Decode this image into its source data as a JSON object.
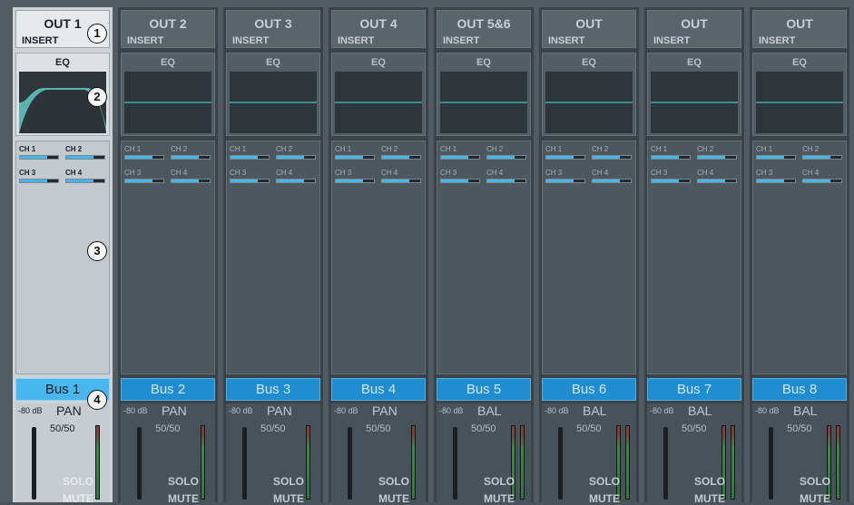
{
  "strips": [
    {
      "title": "OUT 1",
      "insert": "INSERT",
      "eq": "EQ",
      "bus": "Bus 1",
      "db": "-80 dB",
      "pan_mode": "PAN",
      "pan_value": "50/50",
      "solo": "SOLO",
      "mute": "MUTE",
      "selected": true,
      "meters": 1,
      "sends": [
        {
          "label": "CH 1",
          "level": 0.72
        },
        {
          "label": "CH 2",
          "level": 0.72
        },
        {
          "label": "CH 3",
          "level": 0.72
        },
        {
          "label": "CH 4",
          "level": 0.72
        }
      ]
    },
    {
      "title": "OUT 2",
      "insert": "INSERT",
      "eq": "EQ",
      "bus": "Bus 2",
      "db": "-80 dB",
      "pan_mode": "PAN",
      "pan_value": "50/50",
      "solo": "SOLO",
      "mute": "MUTE",
      "selected": false,
      "meters": 1,
      "sends": [
        {
          "label": "CH 1",
          "level": 0.72
        },
        {
          "label": "CH 2",
          "level": 0.72
        },
        {
          "label": "CH 3",
          "level": 0.72
        },
        {
          "label": "CH 4",
          "level": 0.72
        }
      ]
    },
    {
      "title": "OUT 3",
      "insert": "INSERT",
      "eq": "EQ",
      "bus": "Bus 3",
      "db": "-80 dB",
      "pan_mode": "PAN",
      "pan_value": "50/50",
      "solo": "SOLO",
      "mute": "MUTE",
      "selected": false,
      "meters": 1,
      "sends": [
        {
          "label": "CH 1",
          "level": 0.72
        },
        {
          "label": "CH 2",
          "level": 0.72
        },
        {
          "label": "CH 3",
          "level": 0.72
        },
        {
          "label": "CH 4",
          "level": 0.72
        }
      ]
    },
    {
      "title": "OUT 4",
      "insert": "INSERT",
      "eq": "EQ",
      "bus": "Bus 4",
      "db": "-80 dB",
      "pan_mode": "PAN",
      "pan_value": "50/50",
      "solo": "SOLO",
      "mute": "MUTE",
      "selected": false,
      "meters": 1,
      "sends": [
        {
          "label": "CH 1",
          "level": 0.72
        },
        {
          "label": "CH 2",
          "level": 0.72
        },
        {
          "label": "CH 3",
          "level": 0.72
        },
        {
          "label": "CH 4",
          "level": 0.72
        }
      ]
    },
    {
      "title": "OUT 5&6",
      "insert": "INSERT",
      "eq": "EQ",
      "bus": "Bus 5",
      "db": "-80 dB",
      "pan_mode": "BAL",
      "pan_value": "50/50",
      "solo": "SOLO",
      "mute": "MUTE",
      "selected": false,
      "meters": 2,
      "sends": [
        {
          "label": "CH 1",
          "level": 0.72
        },
        {
          "label": "CH 2",
          "level": 0.72
        },
        {
          "label": "CH 3",
          "level": 0.72
        },
        {
          "label": "CH 4",
          "level": 0.72
        }
      ]
    },
    {
      "title": "OUT",
      "insert": "INSERT",
      "eq": "EQ",
      "bus": "Bus 6",
      "db": "-80 dB",
      "pan_mode": "BAL",
      "pan_value": "50/50",
      "solo": "SOLO",
      "mute": "MUTE",
      "selected": false,
      "meters": 2,
      "sends": [
        {
          "label": "CH 1",
          "level": 0.72
        },
        {
          "label": "CH 2",
          "level": 0.72
        },
        {
          "label": "CH 3",
          "level": 0.72
        },
        {
          "label": "CH 4",
          "level": 0.72
        }
      ]
    },
    {
      "title": "OUT",
      "insert": "INSERT",
      "eq": "EQ",
      "bus": "Bus 7",
      "db": "-80 dB",
      "pan_mode": "BAL",
      "pan_value": "50/50",
      "solo": "SOLO",
      "mute": "MUTE",
      "selected": false,
      "meters": 2,
      "sends": [
        {
          "label": "CH 1",
          "level": 0.72
        },
        {
          "label": "CH 2",
          "level": 0.72
        },
        {
          "label": "CH 3",
          "level": 0.72
        },
        {
          "label": "CH 4",
          "level": 0.72
        }
      ]
    },
    {
      "title": "OUT",
      "insert": "INSERT",
      "eq": "EQ",
      "bus": "Bus 8",
      "db": "-80 dB",
      "pan_mode": "BAL",
      "pan_value": "50/50",
      "solo": "SOLO",
      "mute": "MUTE",
      "selected": false,
      "meters": 2,
      "sends": [
        {
          "label": "CH 1",
          "level": 0.72
        },
        {
          "label": "CH 2",
          "level": 0.72
        },
        {
          "label": "CH 3",
          "level": 0.72
        },
        {
          "label": "CH 4",
          "level": 0.72
        }
      ]
    }
  ],
  "callouts": [
    "1",
    "2",
    "3",
    "4"
  ],
  "colors": {
    "accent": "#45b6e8",
    "bus_button": "#1f8dcf",
    "selected_strip": "#cdd2d6",
    "eq_line": "#3fc4c4"
  }
}
